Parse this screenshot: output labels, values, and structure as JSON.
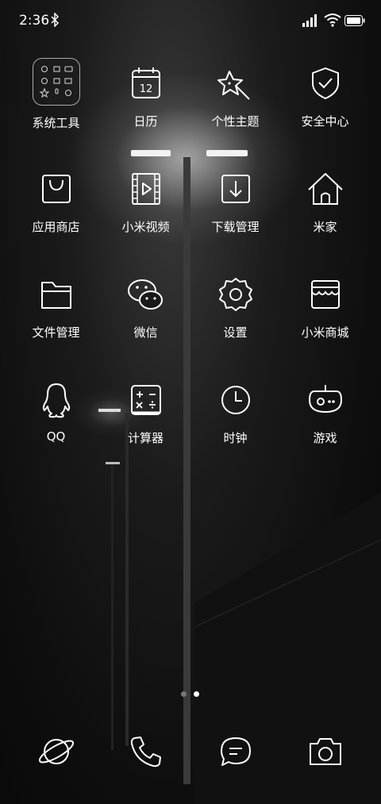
{
  "status_bar": {
    "time": "2:36",
    "icons": [
      "bluetooth-icon",
      "signal-icon",
      "wifi-icon",
      "battery-icon"
    ]
  },
  "apps": [
    {
      "label": "系统工具",
      "icon": "folder-icon"
    },
    {
      "label": "日历",
      "icon": "calendar-icon",
      "calendar_day": "12"
    },
    {
      "label": "个性主题",
      "icon": "theme-star-icon"
    },
    {
      "label": "安全中心",
      "icon": "shield-check-icon"
    },
    {
      "label": "应用商店",
      "icon": "shopping-bag-icon"
    },
    {
      "label": "小米视频",
      "icon": "video-play-icon"
    },
    {
      "label": "下载管理",
      "icon": "download-icon"
    },
    {
      "label": "米家",
      "icon": "home-icon"
    },
    {
      "label": "文件管理",
      "icon": "folder-file-icon"
    },
    {
      "label": "微信",
      "icon": "wechat-icon"
    },
    {
      "label": "设置",
      "icon": "gear-icon"
    },
    {
      "label": "小米商城",
      "icon": "store-icon"
    },
    {
      "label": "QQ",
      "icon": "qq-penguin-icon"
    },
    {
      "label": "计算器",
      "icon": "calculator-icon"
    },
    {
      "label": "时钟",
      "icon": "clock-icon"
    },
    {
      "label": "游戏",
      "icon": "game-icon"
    }
  ],
  "page_indicator": {
    "pages": 2,
    "current": 2
  },
  "dock": [
    "browser-planet-icon",
    "phone-icon",
    "messages-icon",
    "camera-icon"
  ]
}
